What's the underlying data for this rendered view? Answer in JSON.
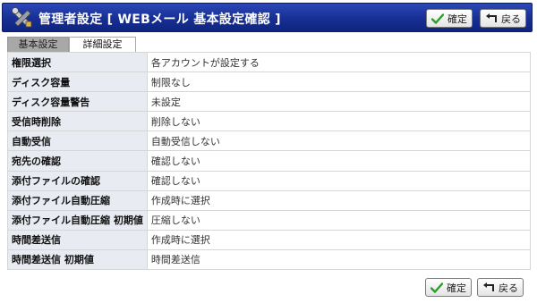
{
  "header": {
    "title": "管理者設定 [ WEBメール 基本設定確認 ]",
    "confirm_label": "確定",
    "back_label": "戻る"
  },
  "tabs": [
    {
      "label": "基本設定",
      "active": false
    },
    {
      "label": "詳細設定",
      "active": true
    }
  ],
  "settings": [
    {
      "label": "権限選択",
      "value": "各アカウントが設定する"
    },
    {
      "label": "ディスク容量",
      "value": "制限なし"
    },
    {
      "label": "ディスク容量警告",
      "value": "未設定"
    },
    {
      "label": "受信時削除",
      "value": "削除しない"
    },
    {
      "label": "自動受信",
      "value": "自動受信しない"
    },
    {
      "label": "宛先の確認",
      "value": "確認しない"
    },
    {
      "label": "添付ファイルの確認",
      "value": "確認しない"
    },
    {
      "label": "添付ファイル自動圧縮",
      "value": "作成時に選択"
    },
    {
      "label": "添付ファイル自動圧縮 初期値",
      "value": "圧縮しない"
    },
    {
      "label": "時間差送信",
      "value": "作成時に選択"
    },
    {
      "label": "時間差送信 初期値",
      "value": "時間差送信"
    }
  ],
  "footer": {
    "confirm_label": "確定",
    "back_label": "戻る"
  },
  "icons": {
    "title": "tools-icon",
    "confirm": "checkmark-icon",
    "back": "return-arrow-icon"
  },
  "colors": {
    "titlebar": "#172f93",
    "label_cell": "#e8ebf2",
    "inactive_tab": "#a8a8a8",
    "check_green": "#2e9b2e"
  }
}
